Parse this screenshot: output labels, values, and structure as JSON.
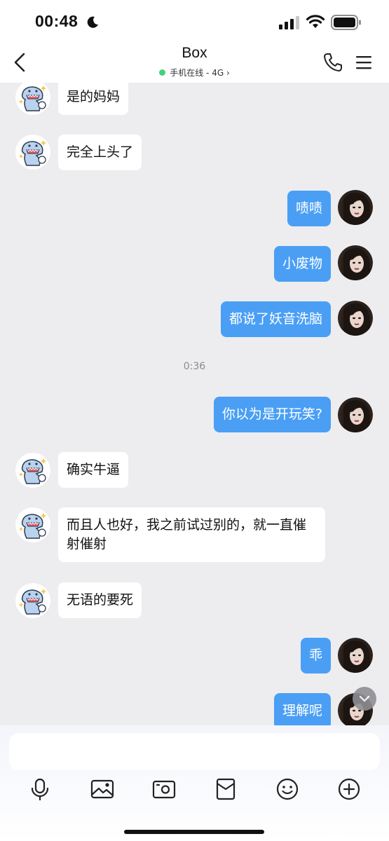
{
  "status_bar": {
    "time": "00:48"
  },
  "header": {
    "title": "Box",
    "subtitle": "手机在线 - 4G",
    "online_color": "#43d17a"
  },
  "colors": {
    "outgoing_bubble": "#4a9ff5",
    "incoming_bubble": "#ffffff"
  },
  "messages": [
    {
      "dir": "in",
      "text": "是的妈妈"
    },
    {
      "dir": "in",
      "text": "完全上头了"
    },
    {
      "dir": "out",
      "text": "啧啧"
    },
    {
      "dir": "out",
      "text": "小废物"
    },
    {
      "dir": "out",
      "text": "都说了妖音洗脑"
    },
    {
      "dir": "time",
      "text": "0:36"
    },
    {
      "dir": "out",
      "text": "你以为是开玩笑?"
    },
    {
      "dir": "in",
      "text": "确实牛逼"
    },
    {
      "dir": "in",
      "text": "而且人也好，我之前试过别的，就一直催射催射"
    },
    {
      "dir": "in",
      "text": "无语的要死"
    },
    {
      "dir": "out",
      "text": "乖"
    },
    {
      "dir": "out",
      "text": "理解呢"
    }
  ],
  "toolbar": [
    "microphone-icon",
    "image-icon",
    "camera-icon",
    "red-packet-icon",
    "emoji-icon",
    "plus-icon"
  ]
}
